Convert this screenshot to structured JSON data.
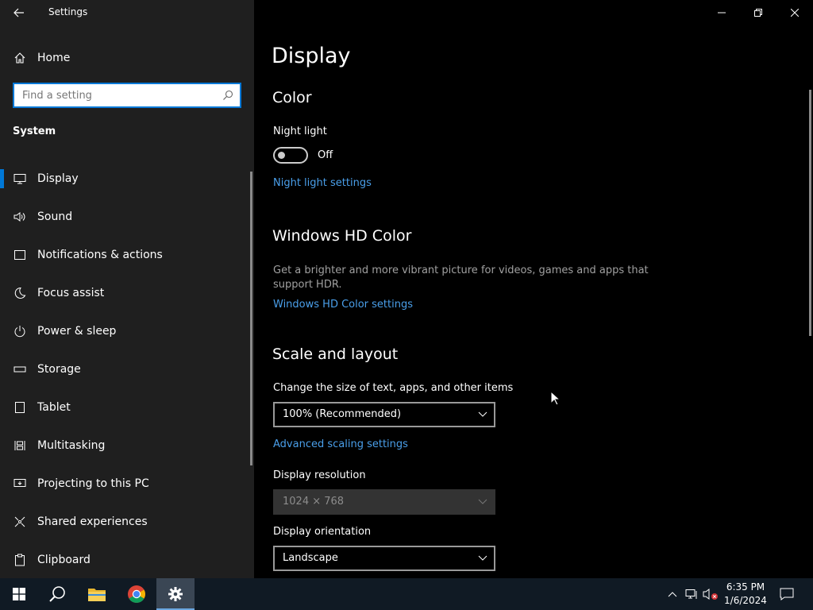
{
  "window": {
    "title": "Settings"
  },
  "sidebar": {
    "home_label": "Home",
    "search_placeholder": "Find a setting",
    "section": "System",
    "items": [
      {
        "label": "Display",
        "icon": "monitor-icon"
      },
      {
        "label": "Sound",
        "icon": "speaker-icon"
      },
      {
        "label": "Notifications & actions",
        "icon": "notification-icon"
      },
      {
        "label": "Focus assist",
        "icon": "moon-icon"
      },
      {
        "label": "Power & sleep",
        "icon": "power-icon"
      },
      {
        "label": "Storage",
        "icon": "storage-icon"
      },
      {
        "label": "Tablet",
        "icon": "tablet-icon"
      },
      {
        "label": "Multitasking",
        "icon": "multitasking-icon"
      },
      {
        "label": "Projecting to this PC",
        "icon": "projecting-icon"
      },
      {
        "label": "Shared experiences",
        "icon": "shared-experiences-icon"
      },
      {
        "label": "Clipboard",
        "icon": "clipboard-icon"
      }
    ],
    "active_item": "Display"
  },
  "main": {
    "title": "Display",
    "color": {
      "heading": "Color",
      "night_light_label": "Night light",
      "night_light_state": "Off",
      "night_light_link": "Night light settings"
    },
    "hdr": {
      "heading": "Windows HD Color",
      "description_line1": "Get a brighter and more vibrant picture for videos, games and apps that",
      "description_line2": "support HDR.",
      "link": "Windows HD Color settings"
    },
    "scale": {
      "heading": "Scale and layout",
      "size_label": "Change the size of text, apps, and other items",
      "size_value": "100% (Recommended)",
      "advanced_link": "Advanced scaling settings",
      "resolution_label": "Display resolution",
      "resolution_value": "1024 × 768",
      "orientation_label": "Display orientation",
      "orientation_value": "Landscape"
    }
  },
  "taskbar": {
    "time": "6:35 PM",
    "date": "1/6/2024"
  },
  "colors": {
    "accent": "#0078d7",
    "link": "#4a9fea",
    "sidebar_bg": "#1f1f1f",
    "taskbar_bg": "#101a24"
  }
}
